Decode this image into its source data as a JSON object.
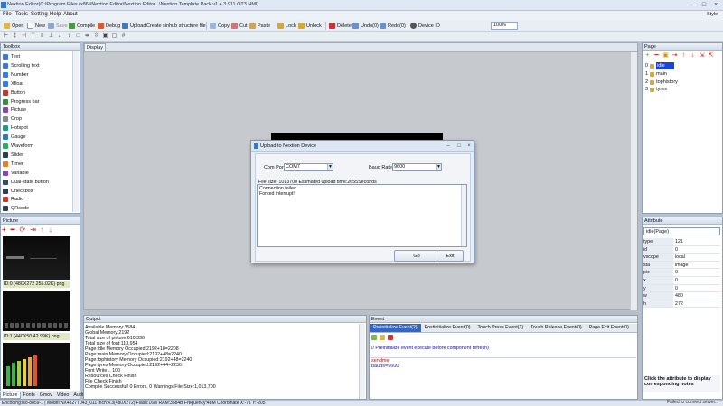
{
  "titlebar": {
    "title": "Nextion Editor(C:\\Program Files (x86)\\Nextion Editor\\Nextion Editor...\\Nextion Template Pack v1.4.3.911 OT3 HMI)",
    "controls": [
      "–",
      "□",
      "×"
    ]
  },
  "menu": {
    "items": [
      "File",
      "Tools",
      "Setting",
      "Help",
      "About"
    ],
    "style_label": "Style"
  },
  "toolbar": {
    "buttons": [
      "Open",
      "New",
      "Save",
      "Compile",
      "Debug",
      "Upload",
      "Create sinhub structure file",
      "Copy",
      "Cut",
      "Paste",
      "Lock",
      "Unlock",
      "Delete",
      "Undo(0)",
      "Redo(0)"
    ],
    "device_id_label": "Device ID",
    "device_id_value": "100%"
  },
  "toolbox": {
    "title": "Toolbox",
    "items": [
      "Text",
      "Scrolling text",
      "Number",
      "Xfloat",
      "Button",
      "Progress bar",
      "Picture",
      "Crop",
      "Hotspot",
      "Gauge",
      "Waveform",
      "Slider",
      "Timer",
      "Variable",
      "Dual-state button",
      "Checkbox",
      "Radio",
      "QRcode"
    ]
  },
  "picture_panel": {
    "title": "Picture",
    "images": [
      {
        "label": "ID:0  (480X272 255.02K) png"
      },
      {
        "label": "ID:1  (440X50 42.99K) png"
      }
    ],
    "tabs": [
      "Picture",
      "Fonts",
      "Gmov",
      "Video",
      "Audio"
    ]
  },
  "display": {
    "tab_label": "Display"
  },
  "upload_dialog": {
    "title": "Upload to Nextion Device",
    "com_port_label": "Com Port:",
    "com_port_value": "COM7",
    "baud_rate_label": "Baud Rate:",
    "baud_rate_value": "9600",
    "file_info": "File size: 1013700  Estimated upload time:2655Seconds",
    "log_lines": [
      "Connection failed",
      "Forced interrupt!"
    ],
    "go_label": "Go",
    "exit_label": "Exit"
  },
  "page_panel": {
    "title": "Page",
    "pages": [
      {
        "index": "0",
        "name": "idle",
        "selected": true
      },
      {
        "index": "1",
        "name": "main"
      },
      {
        "index": "2",
        "name": "tophistory"
      },
      {
        "index": "3",
        "name": "tyres"
      }
    ]
  },
  "attribute_panel": {
    "title": "Attribute",
    "selected_object": "idle(Page)",
    "rows": [
      {
        "key": "type",
        "value": "121"
      },
      {
        "key": "id",
        "value": "0"
      },
      {
        "key": "vscope",
        "value": "local"
      },
      {
        "key": "sta",
        "value": "image"
      },
      {
        "key": "pic",
        "value": "0"
      },
      {
        "key": "x",
        "value": "0"
      },
      {
        "key": "y",
        "value": "0"
      },
      {
        "key": "w",
        "value": "480"
      },
      {
        "key": "h",
        "value": "272"
      }
    ],
    "note": "Click the attribute to display corresponding notes"
  },
  "output_panel": {
    "title": "Output",
    "lines": [
      "Available Memory:3584",
      "Global Memory:2192",
      "Total size of picture:610,336",
      "Total size of font:113,954",
      "Page:idle Memory Occupied:2192+18=2208",
      "Page:main Memory Occupied:2192+48=2240",
      "Page:tophistory Memory Occupied:2192+48=2240",
      "Page:tyres Memory Occupied:2192+44=2236",
      "Font Write... 100",
      "Resources Check Finish",
      "File Check Finish",
      "Compile Successful! 0 Errors, 0 Warnings,File Size:1,013,700"
    ]
  },
  "event_panel": {
    "title": "Event",
    "tabs": [
      "Preinitialize Event(2)",
      "Postinitialize Event(0)",
      "Touch Press Event(1)",
      "Touch Release Event(0)",
      "Page Exit Event(0)"
    ],
    "note": "// Preinitialize event execute before component refresh)",
    "code": [
      {
        "text": "sendme",
        "color": "#cc0000"
      },
      {
        "text": "bauds=9600",
        "color": "#1a1a8a"
      }
    ]
  },
  "statusbar": {
    "left": "Encoding:iso-8859-1 | Model:NX4827T043_011  inch:4.3(480X272) Flash:16M RAM:3584B Frequency:48M      Coordinate X:-71  Y:-205",
    "right": "Failed to connect server..."
  }
}
